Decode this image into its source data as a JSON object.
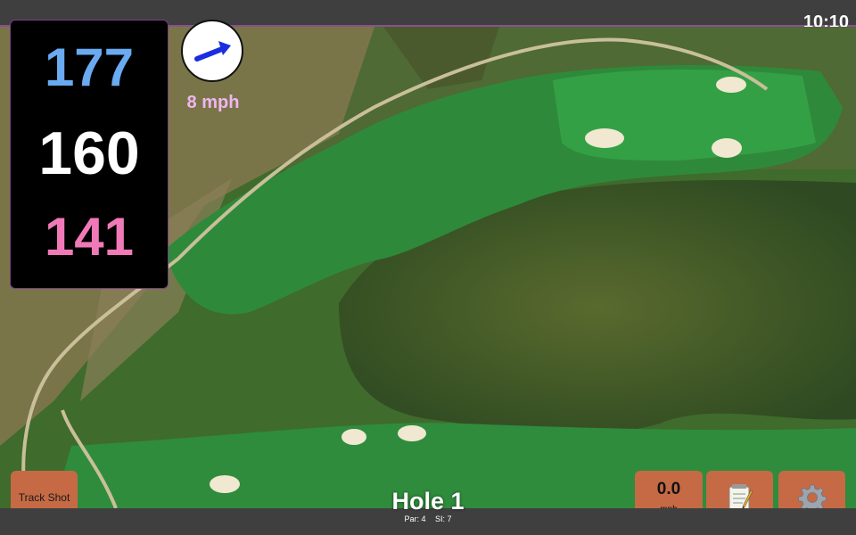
{
  "clock": "10:10",
  "distances": {
    "back": "177",
    "middle": "160",
    "front": "141",
    "back_color": "#6aaaf0",
    "front_color": "#f07ab8"
  },
  "wind": {
    "speed_label": "8 mph",
    "label_color": "#f0b6f0",
    "arrow_color": "#1a2ee0",
    "icon": "wind-direction-arrow-icon"
  },
  "buttons": {
    "track_shot": "Track Shot",
    "speed_value": "0.0",
    "speed_unit": "mph",
    "notes_icon": "notepad-icon",
    "settings_icon": "gear-icon",
    "button_color": "#c56a45"
  },
  "hole": {
    "title": "Hole 1",
    "par": "Par: 4",
    "stroke_index": "SI: 7"
  }
}
